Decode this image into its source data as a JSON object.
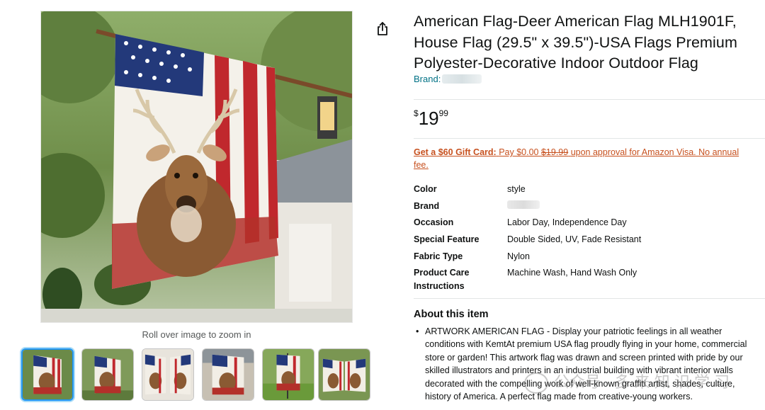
{
  "gallery": {
    "zoom_hint": "Roll over image to zoom in",
    "thumbnail_count": 6,
    "selected_index": 0
  },
  "product": {
    "title": "American Flag-Deer American Flag MLH1901F, House Flag (29.5\" x 39.5\")-USA Flags Premium Polyester-Decorative Indoor Outdoor Flag",
    "brand_label": "Brand:",
    "price_symbol": "$",
    "price_whole": "19",
    "price_fraction": "99",
    "gift_card": {
      "lead": "Get a $60 Gift Card:",
      "pay": "Pay $0.00",
      "old_price": "$19.99",
      "rest": "upon approval for Amazon Visa. No annual fee."
    }
  },
  "specs": [
    {
      "label": "Color",
      "value": "style"
    },
    {
      "label": "Brand",
      "value": ""
    },
    {
      "label": "Occasion",
      "value": "Labor Day, Independence Day"
    },
    {
      "label": "Special Feature",
      "value": "Double Sided, UV, Fade Resistant"
    },
    {
      "label": "Fabric Type",
      "value": "Nylon"
    },
    {
      "label": "Product Care Instructions",
      "value": "Machine Wash, Hand Wash Only"
    }
  ],
  "about": {
    "heading": "About this item",
    "bullets": [
      "ARTWORK AMERICAN FLAG - Display your patriotic feelings in all weather conditions with KemtAt premium USA flag proudly flying in your home, commercial store or garden! This artwork flag was drawn and screen printed with pride by our skilled illustrators and printers in an industrial building with vibrant interior walls decorated with the compelling work of well-known graffiti artist, shades, culture, history of America. A perfect flag made from creative-young workers."
    ]
  },
  "watermark": "公众号 · 多 来 知 识 学 习",
  "colors": {
    "link": "#007185",
    "gift_card": "#c7511f",
    "thumb_selected_border": "#2196f3",
    "text": "#0f1111"
  },
  "icons": {
    "share": "share-icon"
  }
}
